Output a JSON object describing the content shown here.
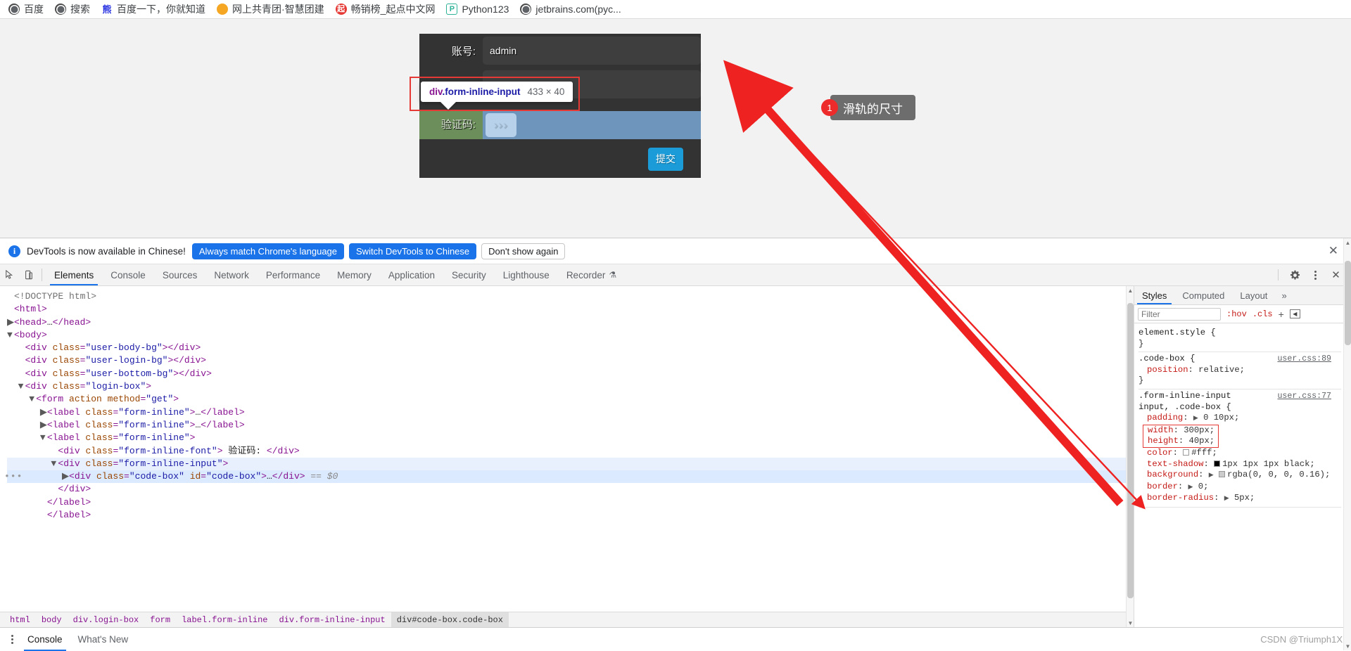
{
  "bookmarks": [
    {
      "label": "百度",
      "icon": "globe-icon"
    },
    {
      "label": "搜索",
      "icon": "globe-icon"
    },
    {
      "label": "百度一下，你就知道",
      "icon": "baidu-icon"
    },
    {
      "label": "网上共青团·智慧团建",
      "icon": "gongqingtuan-icon"
    },
    {
      "label": "畅销榜_起点中文网",
      "icon": "qidian-icon"
    },
    {
      "label": "Python123",
      "icon": "python123-icon"
    },
    {
      "label": "jetbrains.com(pyc...",
      "icon": "globe-icon"
    }
  ],
  "page": {
    "account_label": "账号:",
    "account_value": "admin",
    "password_label": "",
    "verify_label": "验证码:",
    "code_box_text": "›››",
    "submit_label": "提交"
  },
  "inspector_tooltip": {
    "tag": "div",
    "classname": ".form-inline-input",
    "dimensions": "433 × 40"
  },
  "annotation": {
    "badge": "1",
    "label": "滑轨的尺寸"
  },
  "devtools": {
    "notice": {
      "message": "DevTools is now available in Chinese!",
      "info_icon": "info-icon",
      "buttons": [
        {
          "label": "Always match Chrome's language",
          "style": "primary"
        },
        {
          "label": "Switch DevTools to Chinese",
          "style": "primary"
        },
        {
          "label": "Don't show again",
          "style": "secondary"
        }
      ],
      "close_icon": "close-icon"
    },
    "tabs": [
      {
        "label": "Elements",
        "active": true
      },
      {
        "label": "Console",
        "active": false
      },
      {
        "label": "Sources",
        "active": false
      },
      {
        "label": "Network",
        "active": false
      },
      {
        "label": "Performance",
        "active": false
      },
      {
        "label": "Memory",
        "active": false
      },
      {
        "label": "Application",
        "active": false
      },
      {
        "label": "Security",
        "active": false
      },
      {
        "label": "Lighthouse",
        "active": false
      },
      {
        "label": "Recorder",
        "active": false
      }
    ],
    "toolbar_icons": [
      "inspect-icon",
      "device-toolbar-icon",
      "settings-gear-icon",
      "more-options-icon",
      "close-devtools-icon"
    ],
    "dom_lines": [
      {
        "indent": 0,
        "arrow": "",
        "html": "<span class=\"tw\">&lt;!DOCTYPE html&gt;</span>"
      },
      {
        "indent": 0,
        "arrow": "",
        "html": "<span class=\"tg\">&lt;html&gt;</span>"
      },
      {
        "indent": 0,
        "arrow": "right",
        "html": "<span class=\"tg\">&lt;head&gt;</span><span class=\"tt\">…</span><span class=\"tg\">&lt;/head&gt;</span>"
      },
      {
        "indent": 0,
        "arrow": "down",
        "html": "<span class=\"tg\">&lt;body&gt;</span>"
      },
      {
        "indent": 1,
        "arrow": "",
        "html": "<span class=\"tg\">&lt;div </span><span class=\"ta\">class</span><span class=\"tg\">=</span><span class=\"tv\">\"user-body-bg\"</span><span class=\"tg\">&gt;&lt;/div&gt;</span>"
      },
      {
        "indent": 1,
        "arrow": "",
        "html": "<span class=\"tg\">&lt;div </span><span class=\"ta\">class</span><span class=\"tg\">=</span><span class=\"tv\">\"user-login-bg\"</span><span class=\"tg\">&gt;&lt;/div&gt;</span>"
      },
      {
        "indent": 1,
        "arrow": "",
        "html": "<span class=\"tg\">&lt;div </span><span class=\"ta\">class</span><span class=\"tg\">=</span><span class=\"tv\">\"user-bottom-bg\"</span><span class=\"tg\">&gt;&lt;/div&gt;</span>"
      },
      {
        "indent": 1,
        "arrow": "down",
        "html": "<span class=\"tg\">&lt;div </span><span class=\"ta\">class</span><span class=\"tg\">=</span><span class=\"tv\">\"login-box\"</span><span class=\"tg\">&gt;</span>"
      },
      {
        "indent": 2,
        "arrow": "down",
        "html": "<span class=\"tg\">&lt;form </span><span class=\"ta\">action</span><span class=\"tg\"> </span><span class=\"ta\">method</span><span class=\"tg\">=</span><span class=\"tv\">\"get\"</span><span class=\"tg\">&gt;</span>"
      },
      {
        "indent": 3,
        "arrow": "right",
        "html": "<span class=\"tg\">&lt;label </span><span class=\"ta\">class</span><span class=\"tg\">=</span><span class=\"tv\">\"form-inline\"</span><span class=\"tg\">&gt;</span><span class=\"tt\">…</span><span class=\"tg\">&lt;/label&gt;</span>"
      },
      {
        "indent": 3,
        "arrow": "right",
        "html": "<span class=\"tg\">&lt;label </span><span class=\"ta\">class</span><span class=\"tg\">=</span><span class=\"tv\">\"form-inline\"</span><span class=\"tg\">&gt;</span><span class=\"tt\">…</span><span class=\"tg\">&lt;/label&gt;</span>"
      },
      {
        "indent": 3,
        "arrow": "down",
        "html": "<span class=\"tg\">&lt;label </span><span class=\"ta\">class</span><span class=\"tg\">=</span><span class=\"tv\">\"form-inline\"</span><span class=\"tg\">&gt;</span>"
      },
      {
        "indent": 4,
        "arrow": "",
        "html": "<span class=\"tg\">&lt;div </span><span class=\"ta\">class</span><span class=\"tg\">=</span><span class=\"tv\">\"form-inline-font\"</span><span class=\"tg\">&gt;</span><span class=\"tt\"> 验证码: </span><span class=\"tg\">&lt;/div&gt;</span>"
      },
      {
        "indent": 4,
        "arrow": "down",
        "html": "<span class=\"tg\">&lt;div </span><span class=\"ta\">class</span><span class=\"tg\">=</span><span class=\"tv\">\"form-inline-input\"</span><span class=\"tg\">&gt;</span>",
        "sel2": true
      },
      {
        "indent": 5,
        "arrow": "right",
        "html": "<span class=\"tg\">&lt;div </span><span class=\"ta\">class</span><span class=\"tg\">=</span><span class=\"tv\">\"code-box\"</span><span class=\"tg\"> </span><span class=\"ta\">id</span><span class=\"tg\">=</span><span class=\"tv\">\"code-box\"</span><span class=\"tg\">&gt;</span><span class=\"tt\">…</span><span class=\"tg\">&lt;/div&gt;</span><span class=\"tdollar\"> == $0</span>",
        "sel": true,
        "dots": true
      },
      {
        "indent": 4,
        "arrow": "",
        "html": "<span class=\"tg\">&lt;/div&gt;</span>"
      },
      {
        "indent": 3,
        "arrow": "",
        "html": "<span class=\"tg\">&lt;/label&gt;</span>"
      },
      {
        "indent": 3,
        "arrow": "",
        "html": "<span class=\"tg\">&lt;/label&gt;</span>"
      }
    ],
    "breadcrumbs": [
      {
        "label": "html",
        "active": false
      },
      {
        "label": "body",
        "active": false
      },
      {
        "label": "div.login-box",
        "active": false
      },
      {
        "label": "form",
        "active": false
      },
      {
        "label": "label.form-inline",
        "active": false
      },
      {
        "label": "div.form-inline-input",
        "active": false
      },
      {
        "label": "div#code-box.code-box",
        "active": true
      }
    ],
    "styles": {
      "tabs": [
        {
          "label": "Styles",
          "active": true
        },
        {
          "label": "Computed",
          "active": false
        },
        {
          "label": "Layout",
          "active": false
        }
      ],
      "more_label": "»",
      "filter_placeholder": "Filter",
      "hov_label": ":hov",
      "cls_label": ".cls",
      "plus_label": "+",
      "rules": [
        {
          "selector": "element.style {",
          "source": "",
          "declarations": [],
          "close": "}"
        },
        {
          "selector": ".code-box {",
          "source": "user.css:89",
          "declarations": [
            {
              "name": "position",
              "value": "relative;",
              "highlight": false
            }
          ],
          "close": "}"
        },
        {
          "selector": ".form-inline-input\ninput, .code-box {",
          "source": "user.css:77",
          "declarations": [
            {
              "name": "padding",
              "value": "0 10px;",
              "triangle": true,
              "highlight": false
            },
            {
              "name": "width",
              "value": "300px;",
              "highlight": true
            },
            {
              "name": "height",
              "value": "40px;",
              "highlight": true
            },
            {
              "name": "color",
              "value": "#fff;",
              "swatch": "#ffffff",
              "highlight": false
            },
            {
              "name": "text-shadow",
              "value": "1px 1px 1px black;",
              "swatch": "#000000",
              "highlight": false
            },
            {
              "name": "background",
              "value": "rgba(0, 0, 0, 0.16);",
              "triangle": true,
              "swatch": "#cccccc",
              "highlight": false
            },
            {
              "name": "border",
              "value": "0;",
              "triangle": true,
              "highlight": false
            },
            {
              "name": "border-radius",
              "value": "5px;",
              "triangle": true,
              "highlight": false
            }
          ],
          "close": ""
        }
      ]
    },
    "drawer": {
      "tabs": [
        {
          "label": "Console",
          "active": true
        },
        {
          "label": "What's New",
          "active": false
        }
      ],
      "kebab_icon": "more-options-icon"
    },
    "watermark": "CSDN @Triumph1X"
  }
}
